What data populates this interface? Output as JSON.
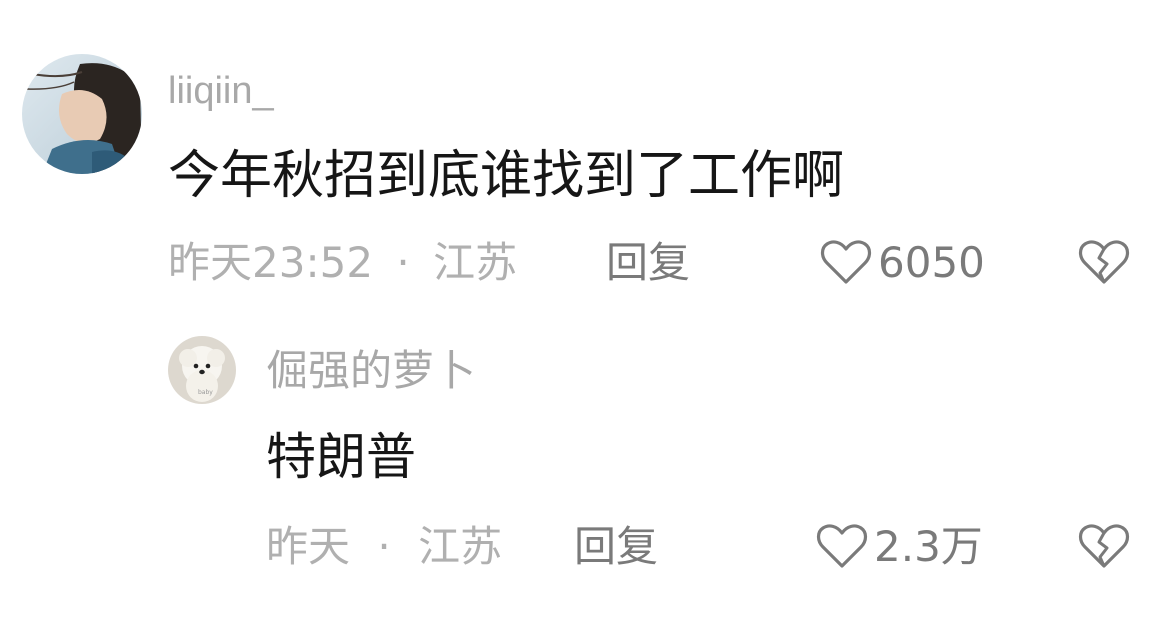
{
  "comments": [
    {
      "username": "liiqiin_",
      "text": "今年秋招到底谁找到了工作啊",
      "time": "昨天23:52",
      "separator": "·",
      "location": "江苏",
      "reply_label": "回复",
      "like_count": "6050",
      "icons": {
        "like": "heart-outline-icon",
        "dislike": "broken-heart-icon"
      }
    },
    {
      "username": "倔强的萝卜",
      "text": "特朗普",
      "time": "昨天",
      "separator": "·",
      "location": "江苏",
      "reply_label": "回复",
      "like_count": "2.3万",
      "avatar_caption": "baby",
      "icons": {
        "like": "heart-outline-icon",
        "dislike": "broken-heart-icon"
      }
    }
  ],
  "colors": {
    "username": "#a8a8a8",
    "content": "#161616",
    "meta": "#b0b0b0",
    "action": "#7a7a7a"
  }
}
